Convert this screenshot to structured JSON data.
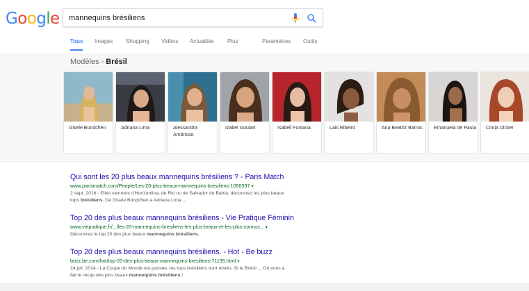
{
  "logo": {
    "letters": [
      "G",
      "o",
      "o",
      "g",
      "l",
      "e"
    ]
  },
  "search": {
    "query": "mannequins brésiliens"
  },
  "icons": {
    "mic": "microphone-icon",
    "search": "magnifier-icon"
  },
  "colors": {
    "link": "#1a0dab",
    "url": "#006621",
    "accent": "#4285f4",
    "snippet": "#545454"
  },
  "tabs": [
    {
      "label": "Tous",
      "active": true
    },
    {
      "label": "Images"
    },
    {
      "label": "Shopping"
    },
    {
      "label": "Vidéos"
    },
    {
      "label": "Actualités"
    },
    {
      "label": "Plus"
    },
    {
      "label": "Paramètres"
    },
    {
      "label": "Outils"
    }
  ],
  "carousel": {
    "breadcrumb_parent": "Modèles",
    "breadcrumb_sep": "›",
    "breadcrumb_current": "Brésil",
    "items": [
      {
        "name": "Gisele Bündchen"
      },
      {
        "name": "Adriana Lima"
      },
      {
        "name": "Alessandra Ambrosio"
      },
      {
        "name": "Izabel Goulart"
      },
      {
        "name": "Isabeli Fontana"
      },
      {
        "name": "Lais Ribeiro"
      },
      {
        "name": "Ana Beatriz Barros"
      },
      {
        "name": "Emanuela de Paula"
      },
      {
        "name": "Cintia Dicker"
      }
    ]
  },
  "results": [
    {
      "title": "Qui sont les 20 plus beaux mannequins brésiliens ? - Paris Match",
      "url": "www.parismatch.com/People/Les-20-plus-beaux-mannequins-bresiliens-1050397",
      "caret": "▾",
      "snippet_line1": "2 sept. 2016 - Elles viennent d'Horizontina, de Rio ou de Salvador de Bahia, découvrez les plus beaux",
      "snippet_line2_pre": "tops ",
      "snippet_line2_bold": "brésiliens",
      "snippet_line2_post": ". De Gisele Bündchen à Adriana Lima ..."
    },
    {
      "title": "Top 20 des plus beaux mannequins brésiliens - Vie Pratique Féminin",
      "url": "www.viepratique.fr/.../les-20-mannequins-bresiliens-les-plus-beaux-et-les-plus-connus...",
      "caret": "▾",
      "snippet_line1_pre": "Découvrez le top 20 des plus beaux ",
      "snippet_line1_bold": "mannequins brésiliens",
      "snippet_line1_post": "."
    },
    {
      "title": "Top 20 des plus beaux mannequins brésiliens. - Hot - Be buzz",
      "url": "buzz.be.com/hot/top-20-des-plus-beaux-mannequins-bresiliens-71135.html",
      "caret": "▾",
      "snippet_line1": "24 juil. 2014 - La Coupe du Monde est passée, les tops brésiliens sont restés. Si le Brésil ... On vous a",
      "snippet_line2_pre": "fait le récap des plus beaux ",
      "snippet_line2_bold": "mannequins brésiliens",
      "snippet_line2_post": " !"
    }
  ]
}
